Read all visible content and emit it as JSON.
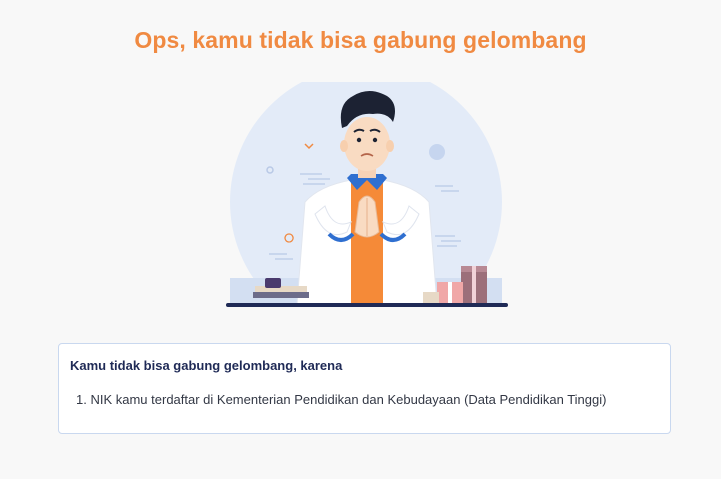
{
  "page": {
    "title": "Ops, kamu tidak bisa gabung gelombang"
  },
  "illustration": {
    "icon": "apologizing-man-illustration"
  },
  "card": {
    "heading": "Kamu tidak bisa gabung gelombang, karena",
    "reasons": [
      {
        "number": "1.",
        "text": "NIK kamu terdaftar di Kementerian Pendidikan dan Kebudayaan (Data Pendidikan Tinggi)"
      }
    ]
  },
  "colors": {
    "accent": "#f08a42",
    "heading": "#1f2a56",
    "card_border": "#c9d8ef",
    "circle_bg": "#e3ebf8"
  }
}
